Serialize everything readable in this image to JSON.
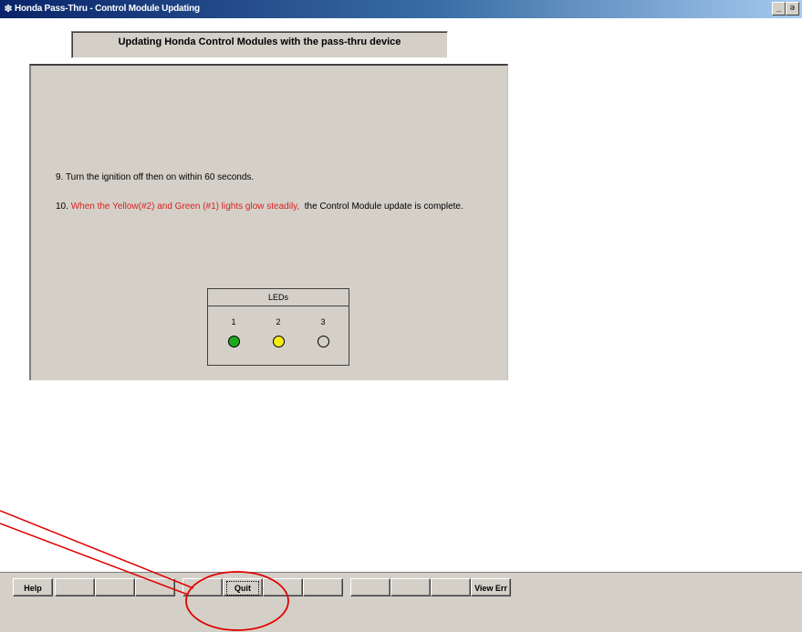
{
  "window": {
    "title": "Honda Pass-Thru - Control Module Updating",
    "minimize_glyph": "_",
    "restore_glyph": "ə"
  },
  "header": {
    "text": "Updating Honda Control Modules with the pass-thru device"
  },
  "instructions": {
    "step9": "9. Turn the ignition off then on within 60 seconds.",
    "step10_prefix": "10. ",
    "step10_red": "When the Yellow(#2) and Green (#1) lights glow steadily,",
    "step10_rest": "  the Control Module update is complete."
  },
  "leds": {
    "label": "LEDs",
    "items": [
      {
        "number": "1",
        "color": "#1fa81f",
        "state": "on"
      },
      {
        "number": "2",
        "color": "#f4ee14",
        "state": "on"
      },
      {
        "number": "3",
        "color": "#d4d0c8",
        "state": "off"
      }
    ]
  },
  "toolbar": {
    "help_label": "Help",
    "quit_label": "Quit",
    "view_err_label": "View Err"
  },
  "annotation": {
    "color": "#e00000",
    "shape": "red circle with arrow pointing to Quit button"
  }
}
